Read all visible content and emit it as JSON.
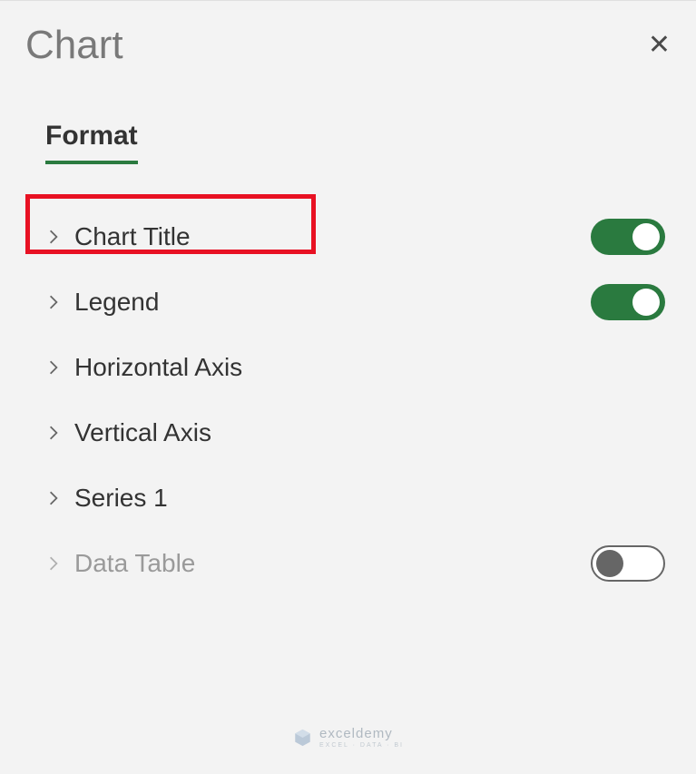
{
  "panel": {
    "title": "Chart"
  },
  "tab": {
    "label": "Format"
  },
  "options": {
    "chartTitle": {
      "label": "Chart Title",
      "toggle": "on"
    },
    "legend": {
      "label": "Legend",
      "toggle": "on"
    },
    "horizontalAxis": {
      "label": "Horizontal Axis"
    },
    "verticalAxis": {
      "label": "Vertical Axis"
    },
    "series1": {
      "label": "Series 1"
    },
    "dataTable": {
      "label": "Data Table",
      "toggle": "off",
      "disabled": true
    }
  },
  "watermark": {
    "brand": "exceldemy",
    "tagline": "EXCEL · DATA · BI"
  },
  "colors": {
    "accent": "#2a7a3f",
    "highlight": "#e81123",
    "panelBg": "#f3f3f3"
  }
}
